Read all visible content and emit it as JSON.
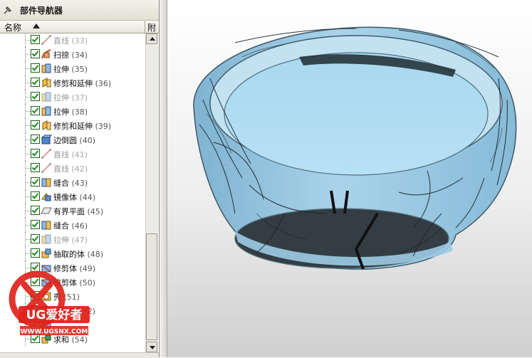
{
  "window": {
    "title": "部件导航器"
  },
  "header": {
    "name_col": "名称",
    "attach_col": "附"
  },
  "tree_items": [
    {
      "label": "直线",
      "num": "(33)",
      "icon": "line-icon",
      "suppressed": true
    },
    {
      "label": "扫掠",
      "num": "(34)",
      "icon": "sweep-icon",
      "suppressed": false
    },
    {
      "label": "拉伸",
      "num": "(35)",
      "icon": "extrude-icon",
      "suppressed": false
    },
    {
      "label": "修剪和延伸",
      "num": "(36)",
      "icon": "trim-extend-icon",
      "suppressed": false
    },
    {
      "label": "拉伸",
      "num": "(37)",
      "icon": "extrude-icon",
      "suppressed": true
    },
    {
      "label": "拉伸",
      "num": "(38)",
      "icon": "extrude-icon",
      "suppressed": false
    },
    {
      "label": "修剪和延伸",
      "num": "(39)",
      "icon": "trim-extend-icon",
      "suppressed": false
    },
    {
      "label": "边倒圆",
      "num": "(40)",
      "icon": "edge-blend-icon",
      "suppressed": false
    },
    {
      "label": "直线",
      "num": "(41)",
      "icon": "line-icon",
      "suppressed": true
    },
    {
      "label": "直线",
      "num": "(42)",
      "icon": "line-icon",
      "suppressed": true
    },
    {
      "label": "缝合",
      "num": "(43)",
      "icon": "sew-icon",
      "suppressed": false
    },
    {
      "label": "镜像体",
      "num": "(44)",
      "icon": "mirror-body-icon",
      "suppressed": false
    },
    {
      "label": "有界平面",
      "num": "(45)",
      "icon": "bounded-plane-icon",
      "suppressed": false
    },
    {
      "label": "缝合",
      "num": "(46)",
      "icon": "sew-icon",
      "suppressed": false
    },
    {
      "label": "拉伸",
      "num": "(47)",
      "icon": "extrude-icon",
      "suppressed": true
    },
    {
      "label": "抽取的体",
      "num": "(48)",
      "icon": "extract-body-icon",
      "suppressed": false
    },
    {
      "label": "修剪体",
      "num": "(49)",
      "icon": "trim-body-icon",
      "suppressed": false
    },
    {
      "label": "修剪体",
      "num": "(50)",
      "icon": "trim-body-icon",
      "suppressed": false
    },
    {
      "label": "壳",
      "num": "(51)",
      "icon": "shell-icon",
      "suppressed": false
    },
    {
      "label": "修剪体",
      "num": "(52)",
      "icon": "trim-body-icon",
      "suppressed": false
    },
    {
      "label": "",
      "num": "",
      "icon": "trim-body-icon",
      "suppressed": false
    },
    {
      "label": "求和",
      "num": "(54)",
      "icon": "unite-icon",
      "suppressed": false
    }
  ],
  "watermark": {
    "brand": "UG爱好者",
    "url": "WWW.UGSNX.COM"
  },
  "colors": {
    "model_surface": "#9ccbe4",
    "model_inner": "#a8d6ef",
    "model_bottom": "#2f3a40",
    "checkbox_green": "#1c8a1c"
  }
}
